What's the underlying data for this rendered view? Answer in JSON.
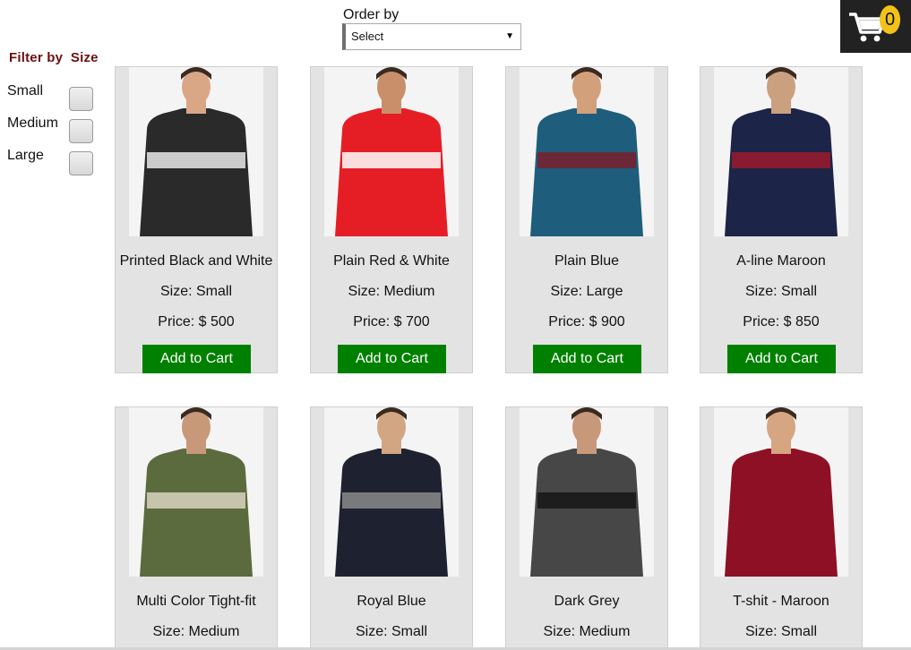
{
  "order": {
    "label": "Order by",
    "selected": "Select"
  },
  "cart": {
    "count": "0",
    "icon": "shopping-cart-icon"
  },
  "filter": {
    "title": "Filter by  Size",
    "options": [
      {
        "label": "Small"
      },
      {
        "label": "Medium"
      },
      {
        "label": "Large"
      }
    ]
  },
  "products": [
    {
      "name": "Printed Black and White",
      "size": "Size: Small",
      "price": "Price: $ 500",
      "button": "Add to Cart",
      "shirt": "#2a2a2a",
      "accent": "#e8e8e8",
      "skin": "#d9a786"
    },
    {
      "name": "Plain Red & White",
      "size": "Size: Medium",
      "price": "Price: $ 700",
      "button": "Add to Cart",
      "shirt": "#e51e26",
      "accent": "#ffffff",
      "skin": "#c98f6b"
    },
    {
      "name": "Plain Blue",
      "size": "Size: Large",
      "price": "Price: $ 900",
      "button": "Add to Cart",
      "shirt": "#1e5d7b",
      "accent": "#7a1f2b",
      "skin": "#d3a07c"
    },
    {
      "name": "A-line Maroon",
      "size": "Size: Small",
      "price": "Price: $ 850",
      "button": "Add to Cart",
      "shirt": "#1c2447",
      "accent": "#9b1a2c",
      "skin": "#caa07e"
    },
    {
      "name": "Multi Color Tight-fit",
      "size": "Size: Medium",
      "price": "",
      "button": "",
      "shirt": "#5b6b3e",
      "accent": "#d9d4c0",
      "skin": "#c79979"
    },
    {
      "name": "Royal Blue",
      "size": "Size: Small",
      "price": "",
      "button": "",
      "shirt": "#1e2230",
      "accent": "#8a8a8a",
      "skin": "#d2a683"
    },
    {
      "name": "Dark Grey",
      "size": "Size: Medium",
      "price": "",
      "button": "",
      "shirt": "#474747",
      "accent": "#161616",
      "skin": "#c8987a"
    },
    {
      "name": "T-shit - Maroon",
      "size": "Size: Small",
      "price": "",
      "button": "",
      "shirt": "#8e1024",
      "accent": "#8e1024",
      "skin": "#d6a582"
    }
  ]
}
